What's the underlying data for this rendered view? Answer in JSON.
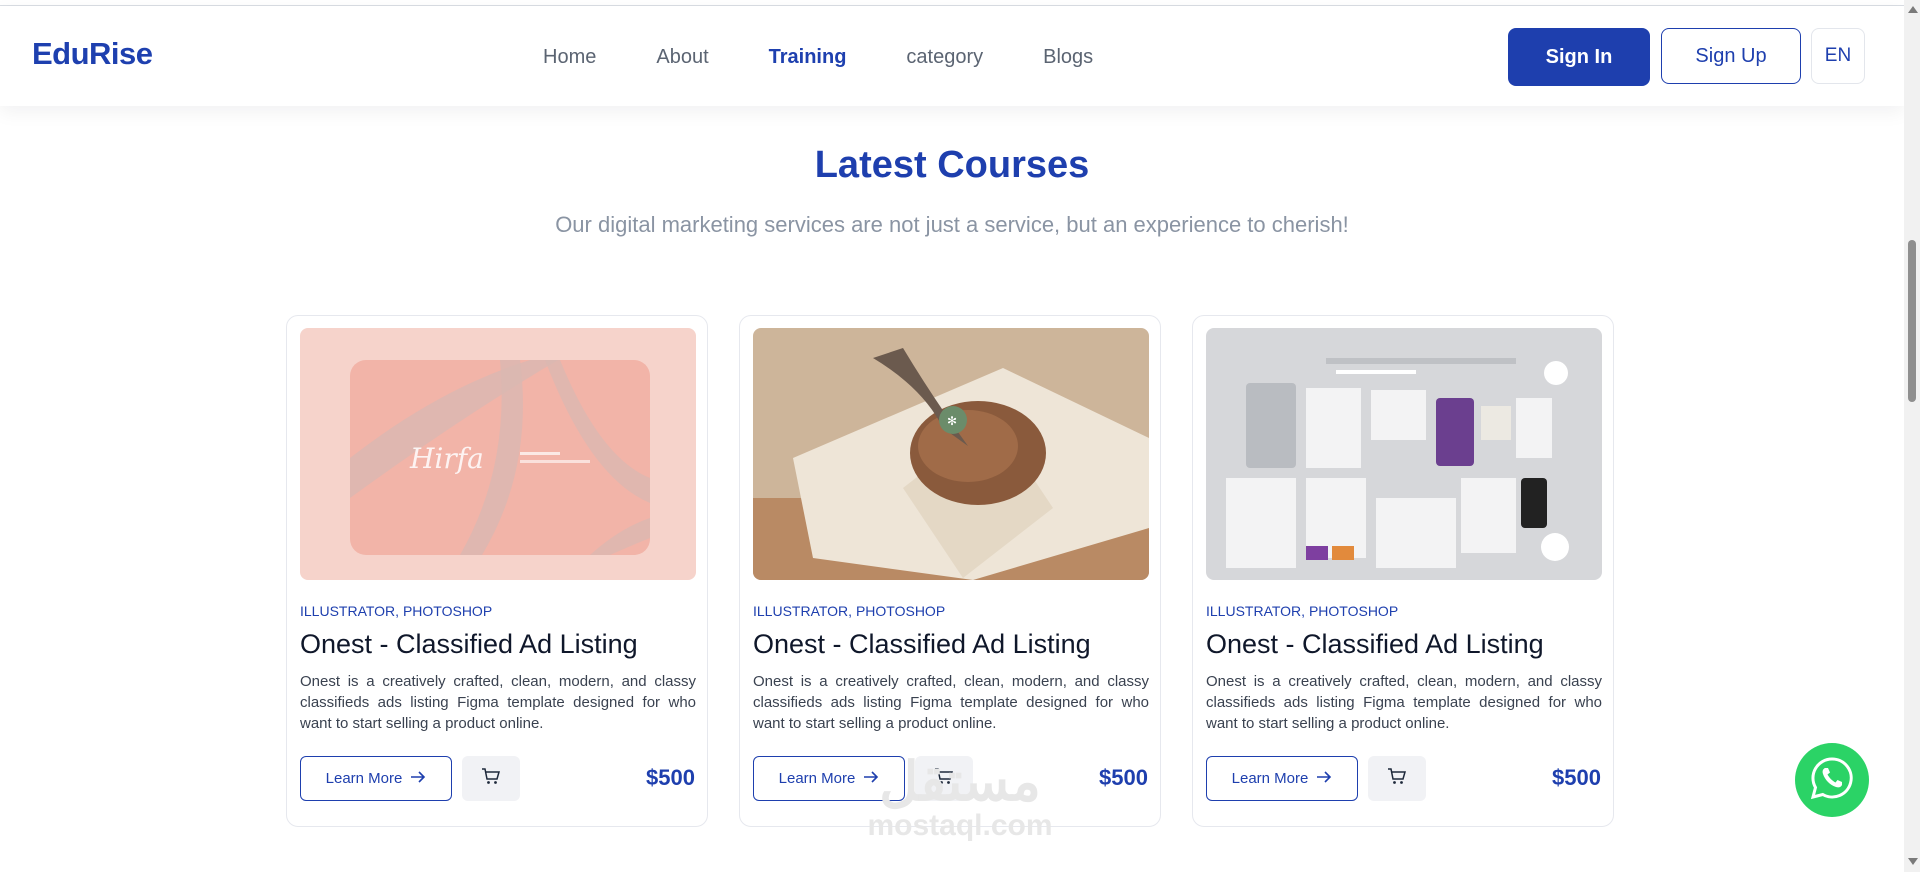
{
  "header": {
    "logo": "EduRise",
    "menu": [
      "Home",
      "About",
      "Training",
      "category",
      "Blogs"
    ],
    "active_menu": "Training",
    "sign_in": "Sign In",
    "sign_up": "Sign Up",
    "language": "EN"
  },
  "section": {
    "title": "Latest Courses",
    "subtitle": "Our digital marketing services are not just a service, but an experience to cherish!"
  },
  "courses": [
    {
      "tags": "ILLUSTRATOR, PHOTOSHOP",
      "title": "Onest - Classified Ad Listing",
      "description": "Onest is a creatively crafted, clean, modern, and classy classifieds ads listing Figma template designed for who want to start selling a product online.",
      "learn_more": "Learn More",
      "price": "$500",
      "image_text": "Hirfa"
    },
    {
      "tags": "ILLUSTRATOR, PHOTOSHOP",
      "title": "Onest - Classified Ad Listing",
      "description": "Onest is a creatively crafted, clean, modern, and classy classifieds ads listing Figma template designed for who want to start selling a product online.",
      "learn_more": "Learn More",
      "price": "$500"
    },
    {
      "tags": "ILLUSTRATOR, PHOTOSHOP",
      "title": "Onest - Classified Ad Listing",
      "description": "Onest is a creatively crafted, clean, modern, and classy classifieds ads listing Figma template designed for who want to start selling a product online.",
      "learn_more": "Learn More",
      "price": "$500"
    }
  ],
  "watermark": {
    "arabic": "مستقل",
    "latin": "mostaql.com"
  },
  "icons": {
    "arrow": "arrow-right-icon",
    "cart": "cart-icon",
    "whatsapp": "whatsapp-icon"
  },
  "colors": {
    "brand": "#1e3fae",
    "whatsapp": "#2bd366"
  }
}
